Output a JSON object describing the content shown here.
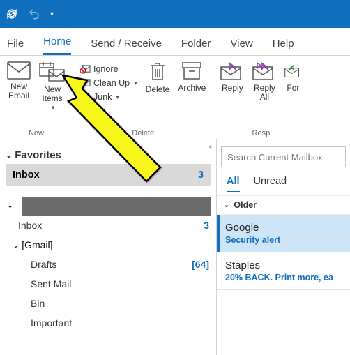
{
  "tabs": [
    "File",
    "Home",
    "Send / Receive",
    "Folder",
    "View",
    "Help"
  ],
  "ribbon": {
    "new_group": "New",
    "new_email": "New\nEmail",
    "new_items": "New\nItems",
    "delete_group": "Delete",
    "ignore": "Ignore",
    "clean_up": "Clean Up",
    "junk": "Junk",
    "delete": "Delete",
    "archive": "Archive",
    "respond_group": "Resp",
    "reply": "Reply",
    "reply_all": "Reply\nAll",
    "forward": "For"
  },
  "nav": {
    "favorites": "Favorites",
    "inbox": "Inbox",
    "inbox_count": "3",
    "tree_inbox": "Inbox",
    "tree_inbox_count": "3",
    "gmail": "[Gmail]",
    "drafts": "Drafts",
    "drafts_count": "[64]",
    "sent": "Sent Mail",
    "bin": "Bin",
    "important": "Important"
  },
  "search": {
    "placeholder": "Search Current Mailbox"
  },
  "filters": {
    "all": "All",
    "unread": "Unread"
  },
  "list": {
    "group": "Older",
    "items": [
      {
        "from": "Google",
        "subject": "Security alert"
      },
      {
        "from": "Staples",
        "subject": "20% BACK. Print more, ea"
      }
    ]
  }
}
